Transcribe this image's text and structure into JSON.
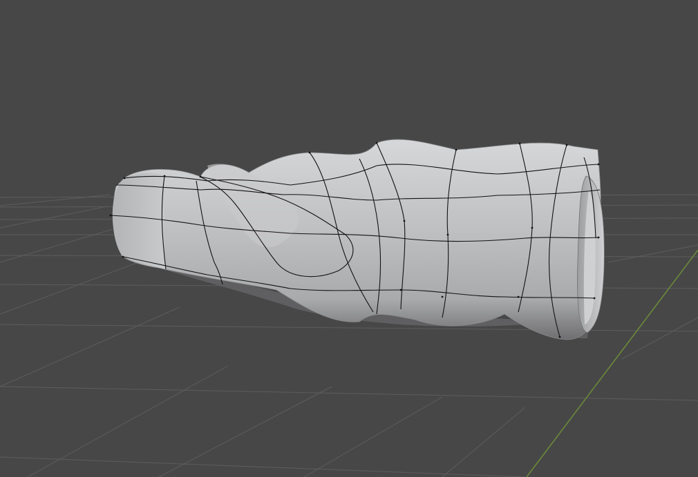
{
  "viewport": {
    "background_color": "#474747",
    "grid_color": "#5d5d5d",
    "y_axis_color": "#6b8a3a",
    "mesh_color": "#c4c5c7",
    "wire_color": "#111111",
    "mesh_label": "twisted-cylinder-mesh"
  }
}
